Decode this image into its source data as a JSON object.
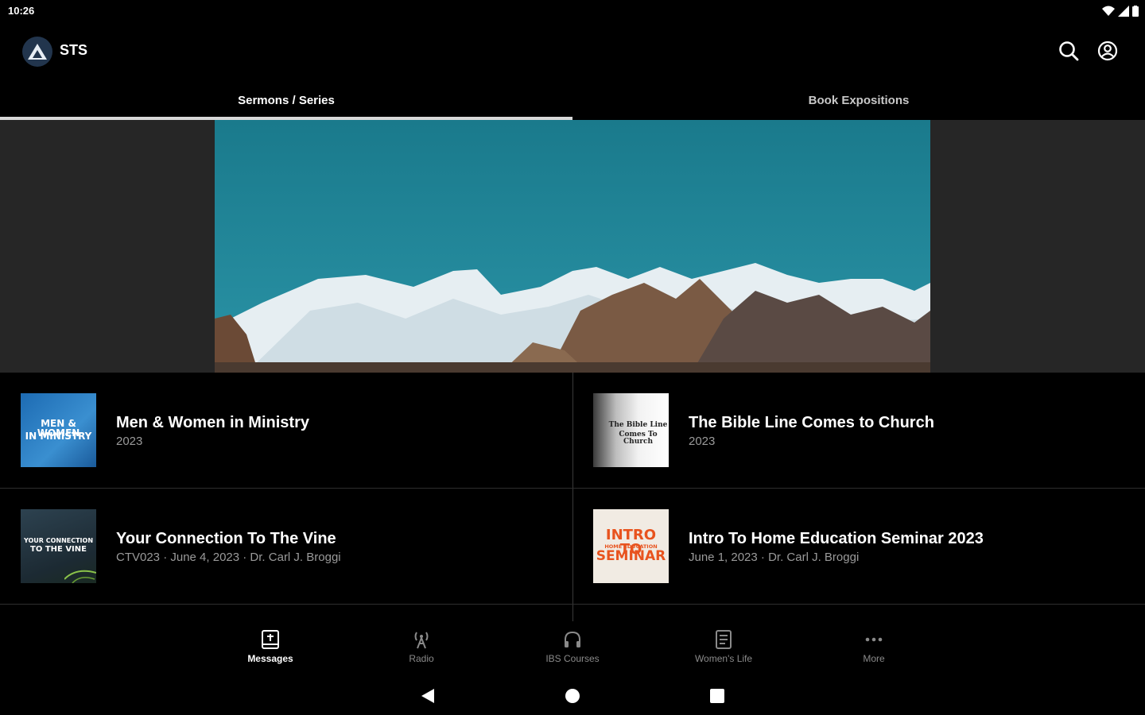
{
  "status_bar": {
    "time": "10:26"
  },
  "app_bar": {
    "title": "STS"
  },
  "tabs": [
    {
      "label": "Sermons / Series",
      "active": true
    },
    {
      "label": "Book Expositions",
      "active": false
    }
  ],
  "items": [
    {
      "title": "Men & Women in Ministry",
      "subtitle": "2023",
      "thumb_lines": [
        "MEN & WOMEN",
        "IN MINISTRY"
      ]
    },
    {
      "title": "The Bible Line Comes to Church",
      "subtitle": "2023",
      "thumb_lines": [
        "The Bible Line",
        "Comes To Church"
      ]
    },
    {
      "title": "Your Connection To The Vine",
      "subtitle": "CTV023 · June 4, 2023 · Dr. Carl J. Broggi",
      "thumb_lines": [
        "YOUR CONNECTION",
        "TO THE VINE"
      ]
    },
    {
      "title": "Intro To Home Education Seminar 2023",
      "subtitle": "June 1, 2023 · Dr. Carl J. Broggi",
      "thumb_lines": [
        "INTRO TO",
        "HOME EDUCATION",
        "SEMINAR"
      ]
    }
  ],
  "bottom_nav": [
    {
      "label": "Messages",
      "icon": "book-icon",
      "active": true
    },
    {
      "label": "Radio",
      "icon": "radio-tower-icon",
      "active": false
    },
    {
      "label": "IBS Courses",
      "icon": "headphones-icon",
      "active": false
    },
    {
      "label": "Women's Life",
      "icon": "document-icon",
      "active": false
    },
    {
      "label": "More",
      "icon": "more-icon",
      "active": false
    }
  ],
  "colors": {
    "background": "#000000",
    "hero_side": "#262626",
    "sky": "#1f7f91"
  }
}
